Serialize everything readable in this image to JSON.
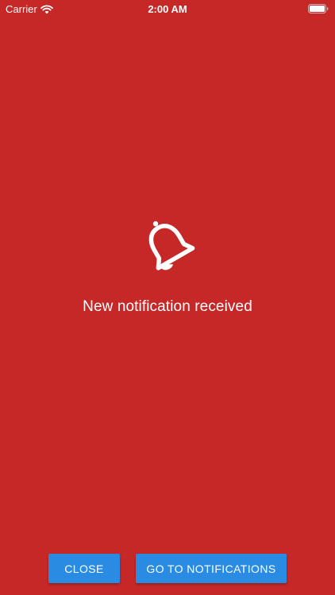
{
  "status_bar": {
    "carrier": "Carrier",
    "time": "2:00 AM",
    "wifi_icon": "wifi-icon",
    "battery_icon": "battery-icon"
  },
  "main": {
    "icon": "bell-icon",
    "message": "New notification received"
  },
  "actions": {
    "close_label": "CLOSE",
    "go_label": "GO TO NOTIFICATIONS"
  },
  "colors": {
    "background": "#C62828",
    "button": "#2A8BE2",
    "text": "#FFFFFF"
  }
}
